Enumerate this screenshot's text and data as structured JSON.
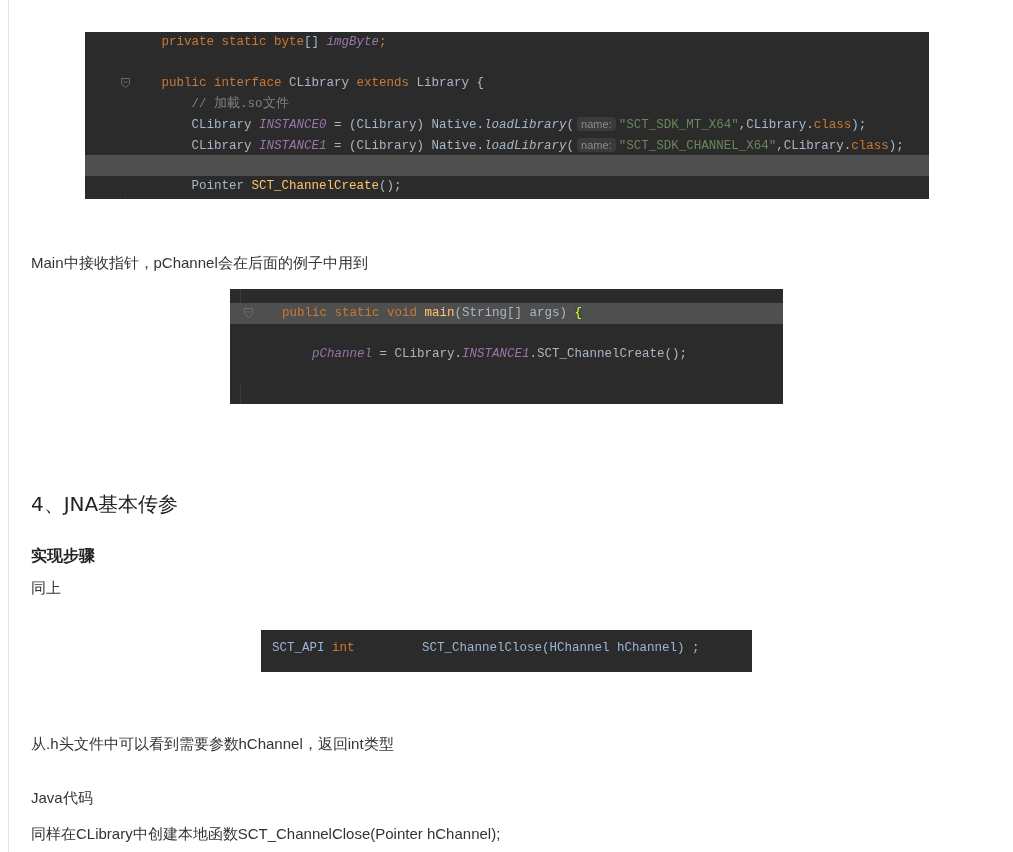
{
  "blocks": [
    {
      "kind": "code",
      "lines": [
        {
          "fold": false,
          "highlighted": false,
          "tokens": [
            {
              "t": "private static ",
              "kind": "keyword"
            },
            {
              "t": "byte",
              "kind": "keyword"
            },
            {
              "t": "[] ",
              "kind": "plain"
            },
            {
              "t": "imgByte",
              "kind": "field"
            },
            {
              "t": ";",
              "kind": "keyword"
            }
          ]
        },
        {
          "fold": false,
          "highlighted": false
        },
        {
          "fold": true,
          "highlighted": false,
          "tokens": [
            {
              "t": "public interface ",
              "kind": "keyword"
            },
            {
              "t": "CLibrary ",
              "kind": "plain"
            },
            {
              "t": "extends ",
              "kind": "keyword"
            },
            {
              "t": "Library {",
              "kind": "plain"
            }
          ]
        },
        {
          "fold": false,
          "highlighted": false,
          "tokens": [
            {
              "t": "    // 加載.so文件",
              "kind": "comment"
            }
          ]
        },
        {
          "fold": false,
          "highlighted": false,
          "tokens": [
            {
              "t": "    CLibrary ",
              "kind": "plain"
            },
            {
              "t": "INSTANCE0",
              "kind": "field"
            },
            {
              "t": " = (CLibrary) Native.",
              "kind": "plain"
            },
            {
              "t": "loadLibrary",
              "kind": "call"
            },
            {
              "t": "(",
              "kind": "plain"
            },
            {
              "t": "name:",
              "kind": "hint"
            },
            {
              "t": "\"SCT_SDK_MT_X64\"",
              "kind": "string"
            },
            {
              "t": ",CLibrary.",
              "kind": "plain"
            },
            {
              "t": "class",
              "kind": "keyword"
            },
            {
              "t": ");",
              "kind": "plain"
            }
          ]
        },
        {
          "fold": false,
          "highlighted": false,
          "tokens": [
            {
              "t": "    CLibrary ",
              "kind": "plain"
            },
            {
              "t": "INSTANCE1",
              "kind": "field"
            },
            {
              "t": " = (CLibrary) Native.",
              "kind": "plain"
            },
            {
              "t": "loadLibrary",
              "kind": "call"
            },
            {
              "t": "(",
              "kind": "plain"
            },
            {
              "t": "name:",
              "kind": "hint"
            },
            {
              "t": "\"SCT_SDK_CHANNEL_X64\"",
              "kind": "string"
            },
            {
              "t": ",CLibrary.",
              "kind": "plain"
            },
            {
              "t": "class",
              "kind": "keyword"
            },
            {
              "t": ");",
              "kind": "plain"
            }
          ]
        },
        {
          "fold": false,
          "highlighted": true
        },
        {
          "fold": false,
          "highlighted": false,
          "tokens": [
            {
              "t": "    Pointer ",
              "kind": "plain"
            },
            {
              "t": "SCT_ChannelCreate",
              "kind": "decl"
            },
            {
              "t": "();",
              "kind": "plain"
            }
          ]
        }
      ]
    },
    {
      "kind": "paragraph",
      "text": "Main中接收指针，pChannel会在后面的例子中用到"
    },
    {
      "kind": "code",
      "lines": [
        {
          "fold": true,
          "highlighted": true,
          "tokens": [
            {
              "t": "public static void ",
              "kind": "keyword"
            },
            {
              "t": "main",
              "kind": "decl"
            },
            {
              "t": "(String[] args) ",
              "kind": "plain"
            },
            {
              "t": "{",
              "kind": "brace"
            }
          ]
        },
        {
          "fold": false,
          "highlighted": false
        },
        {
          "fold": false,
          "highlighted": false,
          "tokens": [
            {
              "t": "    pChannel",
              "kind": "field"
            },
            {
              "t": " = CLibrary.",
              "kind": "plain"
            },
            {
              "t": "INSTANCE1",
              "kind": "field"
            },
            {
              "t": ".SCT_ChannelCreate();",
              "kind": "plain"
            }
          ]
        },
        {
          "fold": false,
          "highlighted": false
        }
      ]
    },
    {
      "kind": "heading",
      "text": "4、JNA基本传参"
    },
    {
      "kind": "subheading",
      "text": "实现步骤"
    },
    {
      "kind": "paragraph",
      "text": "同上"
    },
    {
      "kind": "code",
      "lines": [
        {
          "fold": false,
          "highlighted": false,
          "tokens": [
            {
              "t": "SCT_API ",
              "kind": "macro"
            },
            {
              "t": "int",
              "kind": "keyword"
            },
            {
              "t": "         SCT_ChannelClose(HChannel hChannel) ;",
              "kind": "macro"
            }
          ]
        }
      ]
    },
    {
      "kind": "paragraph",
      "text": "从.h头文件中可以看到需要参数hChannel，返回int类型"
    },
    {
      "kind": "paragraph",
      "text": "Java代码"
    },
    {
      "kind": "paragraph",
      "text": "同样在CLibrary中创建本地函数SCT_ChannelClose(Pointer hChannel);"
    }
  ]
}
